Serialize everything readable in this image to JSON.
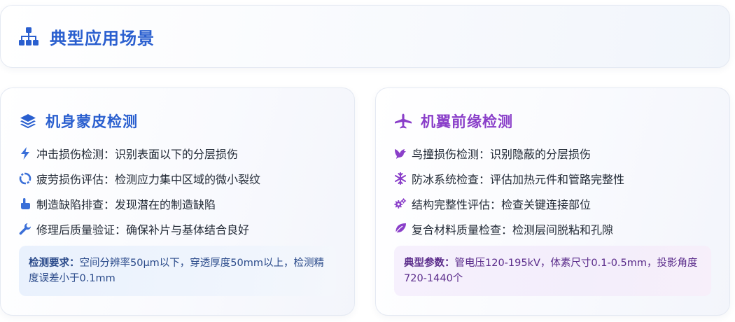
{
  "header": {
    "title": "典型应用场景",
    "icon": "sitemap-icon"
  },
  "colors": {
    "blue_accent": "#2a5fcf",
    "purple_accent": "#8a3fc9"
  },
  "cards": [
    {
      "title": "机身蒙皮检测",
      "icon": "layers-icon",
      "items": [
        {
          "icon": "bolt-icon",
          "text": "冲击损伤检测：识别表面以下的分层损伤"
        },
        {
          "icon": "recycle-icon",
          "text": "疲劳损伤评估：检测应力集中区域的微小裂纹"
        },
        {
          "icon": "hand-point-icon",
          "text": "制造缺陷排查：发现潜在的制造缺陷"
        },
        {
          "icon": "wrench-icon",
          "text": "修理后质量验证：确保补片与基体结合良好"
        }
      ],
      "note_label": "检测要求：",
      "note_text": "空间分辨率50μm以下，穿透厚度50mm以上，检测精度误差小于0.1mm"
    },
    {
      "title": "机翼前缘检测",
      "icon": "plane-icon",
      "items": [
        {
          "icon": "dove-icon",
          "text": "鸟撞损伤检测：识别隐蔽的分层损伤"
        },
        {
          "icon": "snowflake-icon",
          "text": "防冰系统检查：评估加热元件和管路完整性"
        },
        {
          "icon": "gears-icon",
          "text": "结构完整性评估：检查关键连接部位"
        },
        {
          "icon": "leaf-icon",
          "text": "复合材料质量检查：检测层间脱粘和孔隙"
        }
      ],
      "note_label": "典型参数：",
      "note_text": "管电压120-195kV，体素尺寸0.1-0.5mm，投影角度720-1440个"
    }
  ]
}
